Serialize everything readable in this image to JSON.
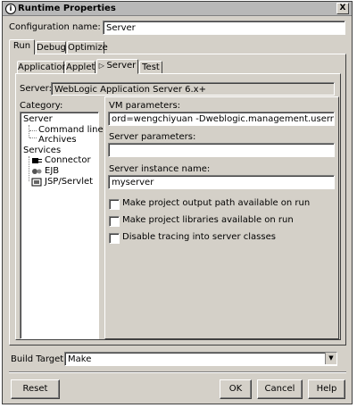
{
  "window": {
    "title": "Runtime Properties",
    "close_glyph": "X"
  },
  "config": {
    "label": "Configuration name:",
    "value": "Server"
  },
  "outer_tabs": [
    "Run",
    "Debug",
    "Optimize"
  ],
  "inner_tabs": [
    "Application",
    "Applet",
    "Server",
    "Test"
  ],
  "server": {
    "label": "Server:",
    "value": "WebLogic Application Server 6.x+"
  },
  "category": {
    "label": "Category:",
    "items": [
      "Server",
      "Command line",
      "Archives",
      "Services",
      "Connector",
      "EJB",
      "JSP/Servlet"
    ]
  },
  "vm": {
    "label": "VM parameters:",
    "value": "ord=wengchiyuan -Dweblogic.management.username=system"
  },
  "server_params": {
    "label": "Server parameters:",
    "value": ""
  },
  "instance": {
    "label": "Server instance name:",
    "value": "myserver"
  },
  "options": [
    {
      "label": "Make project output path available on run",
      "checked": false
    },
    {
      "label": "Make project libraries available on run",
      "checked": false
    },
    {
      "label": "Disable tracing into server classes",
      "checked": false
    }
  ],
  "build_target": {
    "label": "Build Target:",
    "value": "Make"
  },
  "buttons": {
    "reset": "Reset",
    "ok": "OK",
    "cancel": "Cancel",
    "help": "Help"
  }
}
